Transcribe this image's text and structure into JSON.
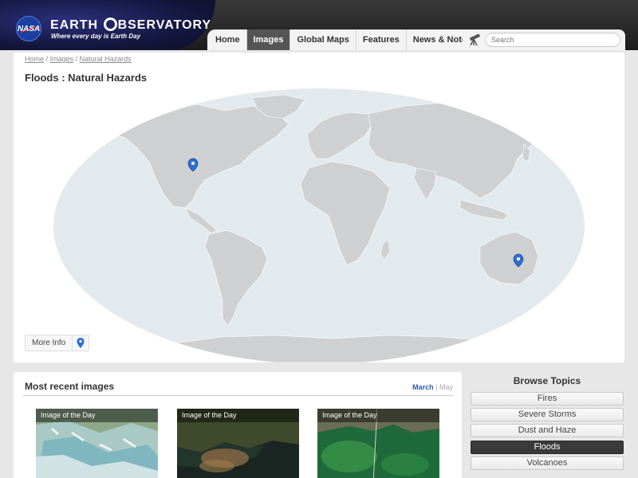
{
  "header": {
    "logo_text": "NASA",
    "site_title_pre": "EARTH",
    "site_title_post": "BSERVATORY",
    "tagline": "Where every day is Earth Day"
  },
  "nav": {
    "tabs": [
      {
        "label": "Home",
        "active": false
      },
      {
        "label": "Images",
        "active": true
      },
      {
        "label": "Global Maps",
        "active": false
      },
      {
        "label": "Features",
        "active": false
      },
      {
        "label": "News & Notes",
        "active": false
      }
    ],
    "search_placeholder": "Search"
  },
  "breadcrumb": {
    "items": [
      "Home",
      "Images",
      "Natural Hazards"
    ],
    "separator": "/"
  },
  "page_title": "Floods : Natural Hazards",
  "map": {
    "ocean_color": "#e3eaee",
    "land_color": "#cfd0d1",
    "markers": [
      {
        "region": "North America (Gulf Coast)",
        "lat": 31,
        "lon": -96
      },
      {
        "region": "Australia (Queensland)",
        "lat": -25,
        "lon": 145
      }
    ],
    "more_info_label": "More Info"
  },
  "recent": {
    "title": "Most recent images",
    "month_current": "March",
    "month_separator": "|",
    "month_other": "May",
    "thumbs": [
      {
        "label": "Image of the Day"
      },
      {
        "label": "Image of the Day"
      },
      {
        "label": "Image of the Day"
      }
    ]
  },
  "browse": {
    "title": "Browse Topics",
    "topics": [
      {
        "label": "Fires",
        "active": false
      },
      {
        "label": "Severe Storms",
        "active": false
      },
      {
        "label": "Dust and Haze",
        "active": false
      },
      {
        "label": "Floods",
        "active": true
      },
      {
        "label": "Volcanoes",
        "active": false
      }
    ]
  },
  "colors": {
    "accent_link": "#2a5ea8",
    "active_tab": "#555555",
    "marker": "#2f6fd0"
  }
}
